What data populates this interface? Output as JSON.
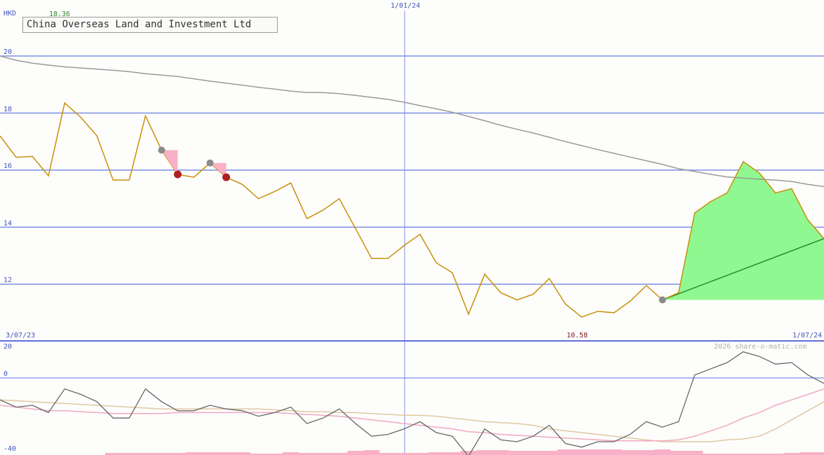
{
  "title": "China Overseas Land and Investment Ltd",
  "currency": "HKD",
  "max_label": "18.36",
  "min_label": "10.58",
  "date_mid": "1/01/24",
  "date_start": "3/07/23",
  "date_end": "1/07/24",
  "copyright": "2026 share-o-matic.com",
  "colors": {
    "price": "#c8900a",
    "ma_long": "#9a9a9a",
    "grid": "#7d8ee8",
    "axis_text": "#4455bb",
    "forecast_fill": "#90f890",
    "trend": "#2a8a2a",
    "marker_down": "#b02020",
    "marker_up": "#8a8a8a",
    "drop_fill": "#f8b0c8",
    "osc": "#666666",
    "osc_pink": "#f0a8c0",
    "osc_tan": "#e0c8a0",
    "volume": "#f8b0c8",
    "max_text": "#2a8a2a",
    "min_text": "#7a2020"
  },
  "chart_data": [
    {
      "type": "line",
      "name": "price",
      "ylim": [
        10.3,
        20.15
      ],
      "yticks": [
        20,
        18,
        16,
        14,
        12
      ],
      "x": [
        0,
        1,
        2,
        3,
        4,
        5,
        6,
        7,
        8,
        9,
        10,
        11,
        12,
        13,
        14,
        15,
        16,
        17,
        18,
        19,
        20,
        21,
        22,
        23,
        24,
        25,
        26,
        27,
        28,
        29,
        30,
        31,
        32,
        33,
        34,
        35,
        36,
        37,
        38,
        39,
        40,
        41,
        42,
        43,
        44,
        45,
        46,
        47,
        48,
        49,
        50,
        51
      ],
      "price": [
        17.2,
        16.45,
        16.48,
        15.8,
        18.35,
        17.85,
        17.2,
        15.65,
        15.65,
        17.9,
        16.7,
        15.85,
        15.75,
        16.25,
        15.75,
        15.5,
        15.0,
        15.25,
        15.55,
        14.3,
        14.6,
        15.0,
        13.95,
        12.9,
        12.9,
        13.35,
        13.75,
        12.75,
        12.4,
        10.95,
        12.35,
        11.7,
        11.45,
        11.65,
        12.2,
        11.3,
        10.85,
        11.05,
        11.0,
        11.4,
        11.95,
        11.45,
        11.7,
        14.5,
        14.9,
        15.2,
        16.3,
        15.9,
        15.2,
        15.35,
        14.25,
        13.6
      ],
      "ma_long": [
        20.0,
        19.85,
        19.75,
        19.68,
        19.62,
        19.58,
        19.54,
        19.5,
        19.45,
        19.38,
        19.33,
        19.28,
        19.2,
        19.12,
        19.05,
        18.98,
        18.9,
        18.84,
        18.77,
        18.72,
        18.72,
        18.68,
        18.62,
        18.55,
        18.48,
        18.38,
        18.26,
        18.15,
        18.03,
        17.88,
        17.73,
        17.57,
        17.43,
        17.3,
        17.15,
        17.0,
        16.86,
        16.72,
        16.59,
        16.46,
        16.33,
        16.2,
        16.05,
        15.95,
        15.85,
        15.76,
        15.72,
        15.68,
        15.65,
        15.6,
        15.5,
        15.42
      ],
      "forecast_base": 11.45,
      "trend_line": {
        "from": [
          41,
          11.45
        ],
        "to": [
          51,
          13.6
        ]
      },
      "down_markers": [
        {
          "from": [
            10,
            16.7
          ],
          "to": [
            11,
            15.85
          ]
        },
        {
          "from": [
            13,
            16.25
          ],
          "to": [
            14,
            15.75
          ]
        }
      ],
      "up_marker": [
        41,
        11.45
      ]
    },
    {
      "type": "line",
      "name": "oscillator",
      "ylim": [
        -40,
        20
      ],
      "yticks": [
        20,
        0,
        -40
      ],
      "osc": [
        -12,
        -16,
        -15,
        -19,
        -6,
        -9,
        -13,
        -22,
        -22,
        -6,
        -13,
        -18,
        -18,
        -15,
        -17,
        -18,
        -21,
        -19,
        -16,
        -25,
        -22,
        -17,
        -25,
        -32,
        -31,
        -28,
        -24,
        -30,
        -32,
        -43,
        -28,
        -34,
        -35,
        -32,
        -26,
        -36,
        -38,
        -35,
        -35,
        -31,
        -24,
        -27,
        -24,
        2,
        6,
        10,
        17,
        14,
        9,
        10,
        2,
        -3
      ],
      "ma_pink": [
        -15,
        -16,
        -17,
        -18,
        -18,
        -18.5,
        -19,
        -19.5,
        -19.5,
        -19.5,
        -19.5,
        -19,
        -19,
        -19,
        -19,
        -19,
        -19,
        -19,
        -19.5,
        -20,
        -20.5,
        -21,
        -22,
        -23,
        -24,
        -25,
        -26,
        -27,
        -28,
        -29.5,
        -30,
        -31,
        -31.5,
        -32,
        -32.5,
        -33,
        -33.5,
        -34,
        -34.5,
        -34.5,
        -34.5,
        -34.5,
        -34,
        -32,
        -29,
        -26,
        -22,
        -19,
        -15,
        -12,
        -9,
        -6
      ],
      "ma_tan": [
        -12,
        -12.5,
        -13,
        -13.5,
        -14,
        -14.5,
        -15,
        -15.5,
        -16,
        -16.5,
        -17,
        -17,
        -17,
        -17,
        -17,
        -17,
        -17,
        -17.5,
        -18,
        -18.5,
        -18.5,
        -19,
        -19,
        -19.5,
        -20,
        -20.5,
        -20.5,
        -21,
        -22,
        -23,
        -24,
        -24.5,
        -25,
        -26,
        -28,
        -29,
        -30,
        -31,
        -32,
        -33,
        -34,
        -35,
        -35,
        -35,
        -35,
        -34,
        -33.5,
        -32,
        -28,
        -23,
        -18,
        -13
      ],
      "volume": [
        0,
        0,
        0,
        0,
        0,
        0,
        0,
        1.5,
        1.5,
        1.5,
        1.5,
        1.5,
        2,
        2,
        2,
        2,
        1,
        1,
        2,
        1.5,
        1.5,
        1.5,
        3,
        3.5,
        1.5,
        1.5,
        1.5,
        2,
        2,
        3,
        3.5,
        3.5,
        3,
        3,
        3,
        4,
        4,
        4,
        4,
        3.5,
        3.5,
        4,
        3,
        3,
        1,
        1,
        1,
        1,
        1,
        1.5,
        2,
        2
      ]
    }
  ]
}
